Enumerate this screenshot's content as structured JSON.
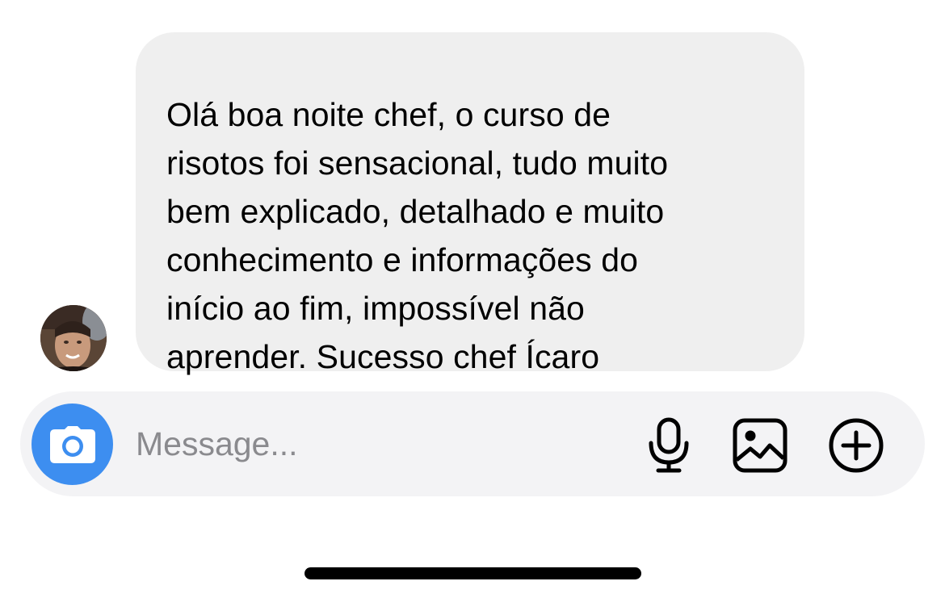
{
  "conversation": {
    "received_message": {
      "lines": [
        "Olá boa noite chef, o curso de",
        "risotos foi sensacional, tudo muito",
        "bem explicado, detalhado e muito",
        "conhecimento e informações do",
        "início ao fim, impossível não",
        "aprender. Sucesso chef Ícaro"
      ],
      "sender_avatar": "user-avatar"
    }
  },
  "composer": {
    "placeholder": "Message...",
    "value": "",
    "camera_icon": "camera-icon",
    "mic_icon": "microphone-icon",
    "gallery_icon": "image-gallery-icon",
    "plus_icon": "plus-circle-icon",
    "accent_color": "#3d8ef0"
  }
}
